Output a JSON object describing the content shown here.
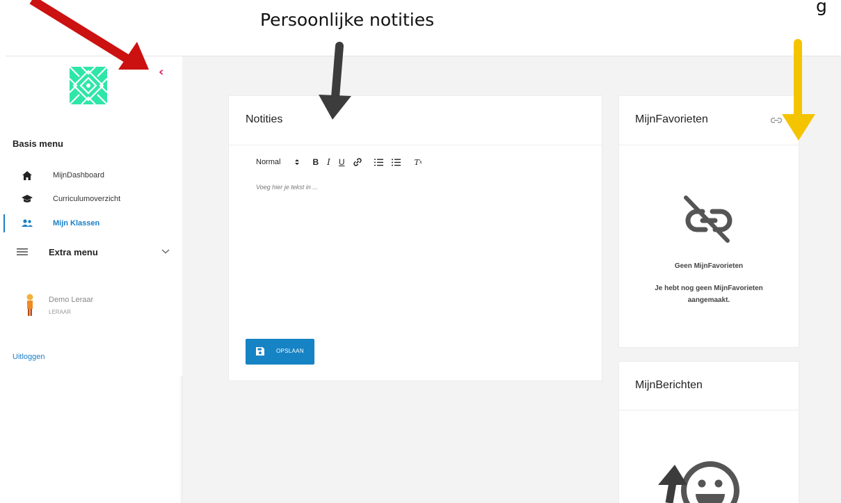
{
  "annotation": {
    "caption_center": "Persoonlijke notities",
    "caption_right_fragment": "g"
  },
  "sidebar": {
    "basis_heading": "Basis menu",
    "items": [
      {
        "label": "MijnDashboard",
        "icon": "home-icon"
      },
      {
        "label": "Curriculumoverzicht",
        "icon": "graduation-cap-icon"
      },
      {
        "label": "Mijn Klassen",
        "icon": "users-icon",
        "active": true
      }
    ],
    "extra_label": "Extra menu",
    "user_name": "Demo Leraar",
    "user_role": "LERAAR",
    "logout": "Uitloggen"
  },
  "notes": {
    "title": "Notities",
    "toolbar_format": "Normal",
    "placeholder": "Voeg hier je tekst in ...",
    "save_label": "OPSLAAN"
  },
  "favorites": {
    "title": "MijnFavorieten",
    "empty_title": "Geen MijnFavorieten",
    "empty_text": "Je hebt nog geen MijnFavorieten aangemaakt."
  },
  "messages": {
    "title": "MijnBerichten"
  },
  "colors": {
    "accent": "#1683c4",
    "active_link": "#1a7fc7",
    "collapse": "#e01a5a",
    "logo": "#2ee6a8",
    "arrow_red": "#cc1111",
    "arrow_yellow": "#f5c400",
    "arrow_dark": "#3c3c3c"
  }
}
